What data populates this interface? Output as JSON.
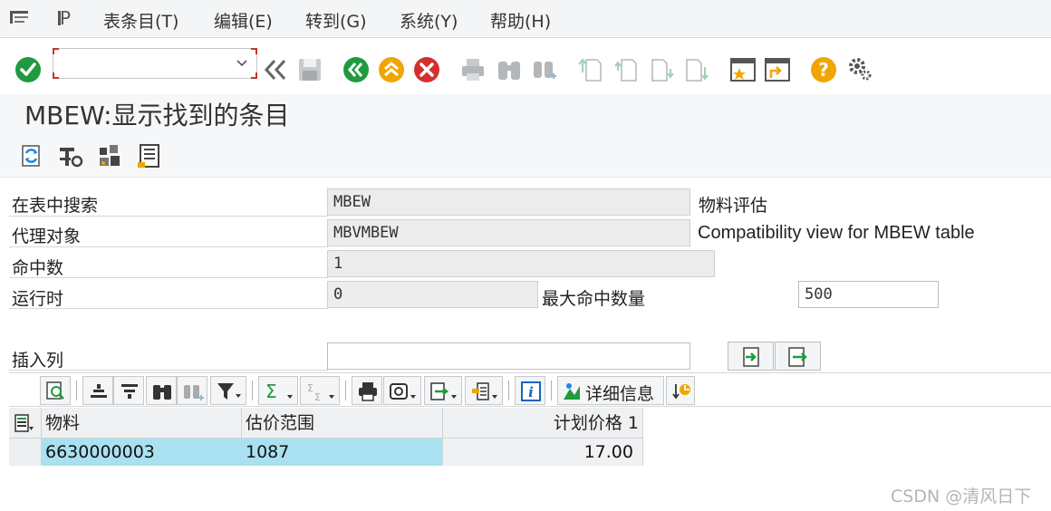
{
  "menu": {
    "items": [
      "表条目(T)",
      "编辑(E)",
      "转到(G)",
      "系统(Y)",
      "帮助(H)"
    ]
  },
  "toolbar": {
    "command_value": "",
    "icons": [
      "enter-icon",
      "command-dropdown-icon",
      "back-double-icon",
      "save-icon",
      "back-icon",
      "exit-icon",
      "cancel-icon",
      "print-icon",
      "find-icon",
      "find-next-icon",
      "first-page-icon",
      "prev-page-icon",
      "next-page-icon",
      "last-page-icon",
      "create-session-icon",
      "shortcut-icon",
      "help-icon",
      "customize-icon"
    ]
  },
  "title": "MBEW:显示找到的条目",
  "app_toolbar": {
    "icons": [
      "refresh-icon",
      "settings-icon",
      "structure-icon",
      "document-icon"
    ]
  },
  "form": {
    "search_table_label": "在表中搜索",
    "search_table_value": "MBEW",
    "search_table_desc": "物料评估",
    "proxy_object_label": "代理对象",
    "proxy_object_value": "MBVMBEW",
    "proxy_object_desc": "Compatibility view for MBEW table",
    "hits_label": "命中数",
    "hits_value": "1",
    "runtime_label": "运行时",
    "runtime_value": "0",
    "max_hits_label": "最大命中数量",
    "max_hits_value": "500",
    "insert_col_label": "插入列",
    "insert_col_value": ""
  },
  "alv_toolbar": {
    "detail_label": "详细信息",
    "icons": [
      "detail-view-icon",
      "sort-ascending-icon",
      "sort-descending-icon",
      "find-icon",
      "find-next-icon",
      "filter-icon",
      "sum-icon",
      "subtotal-icon",
      "print-icon",
      "view-icon",
      "export-icon",
      "layout-icon",
      "info-icon",
      "chart-icon",
      "abc-analysis-icon"
    ]
  },
  "grid": {
    "headers": [
      "物料",
      "估价范围",
      "计划价格 1"
    ],
    "rows": [
      [
        "6630000003",
        "1087",
        "17.00"
      ]
    ]
  },
  "watermark": "CSDN @清风日下",
  "colors": {
    "accent_green": "#1f9a3e",
    "accent_orange": "#f0a500",
    "cancel_red": "#d32f2f",
    "key_cell": "#a9e1f0"
  }
}
